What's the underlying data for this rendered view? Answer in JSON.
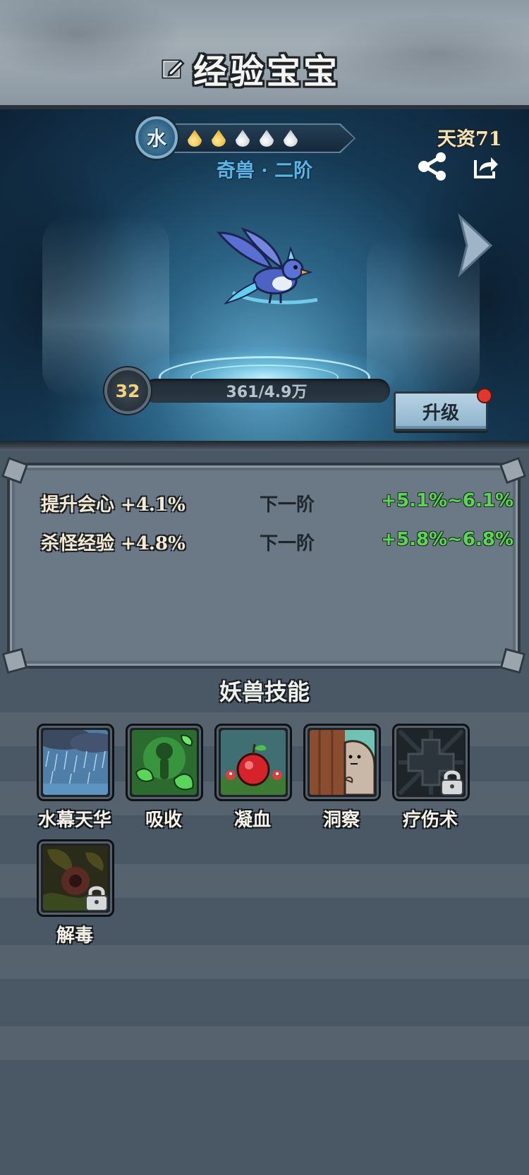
{
  "header": {
    "title": "经验宝宝",
    "edit_icon": "edit-icon"
  },
  "pet": {
    "element": "水",
    "stars_filled": 2,
    "stars_total": 5,
    "rank": "奇兽 · 二阶",
    "talent": "天资71",
    "level": "32",
    "exp_text": "361/4.9万",
    "exp_fraction": 0.007,
    "upgrade_label": "升级",
    "has_notification": true
  },
  "stats": [
    {
      "name": "提升会心 +4.1%",
      "next_label": "下一阶",
      "range": "+5.1%~6.1%"
    },
    {
      "name": "杀怪经验 +4.8%",
      "next_label": "下一阶",
      "range": "+5.8%~6.8%"
    }
  ],
  "skills_section": {
    "title": "妖兽技能",
    "skills": [
      {
        "name": "水幕天华",
        "icon": "rain-icon",
        "locked": false
      },
      {
        "name": "吸收",
        "icon": "absorb-icon",
        "locked": false
      },
      {
        "name": "凝血",
        "icon": "apple-icon",
        "locked": false
      },
      {
        "name": "洞察",
        "icon": "peek-icon",
        "locked": false
      },
      {
        "name": "疗伤术",
        "icon": "heal-cross-icon",
        "locked": true
      },
      {
        "name": "解毒",
        "icon": "antidote-icon",
        "locked": true
      }
    ]
  },
  "colors": {
    "background": "#4a5765",
    "upgrade_button": "#9dc0d6",
    "range_green": "#5ed35a",
    "rank_blue": "#5bb4e6"
  }
}
